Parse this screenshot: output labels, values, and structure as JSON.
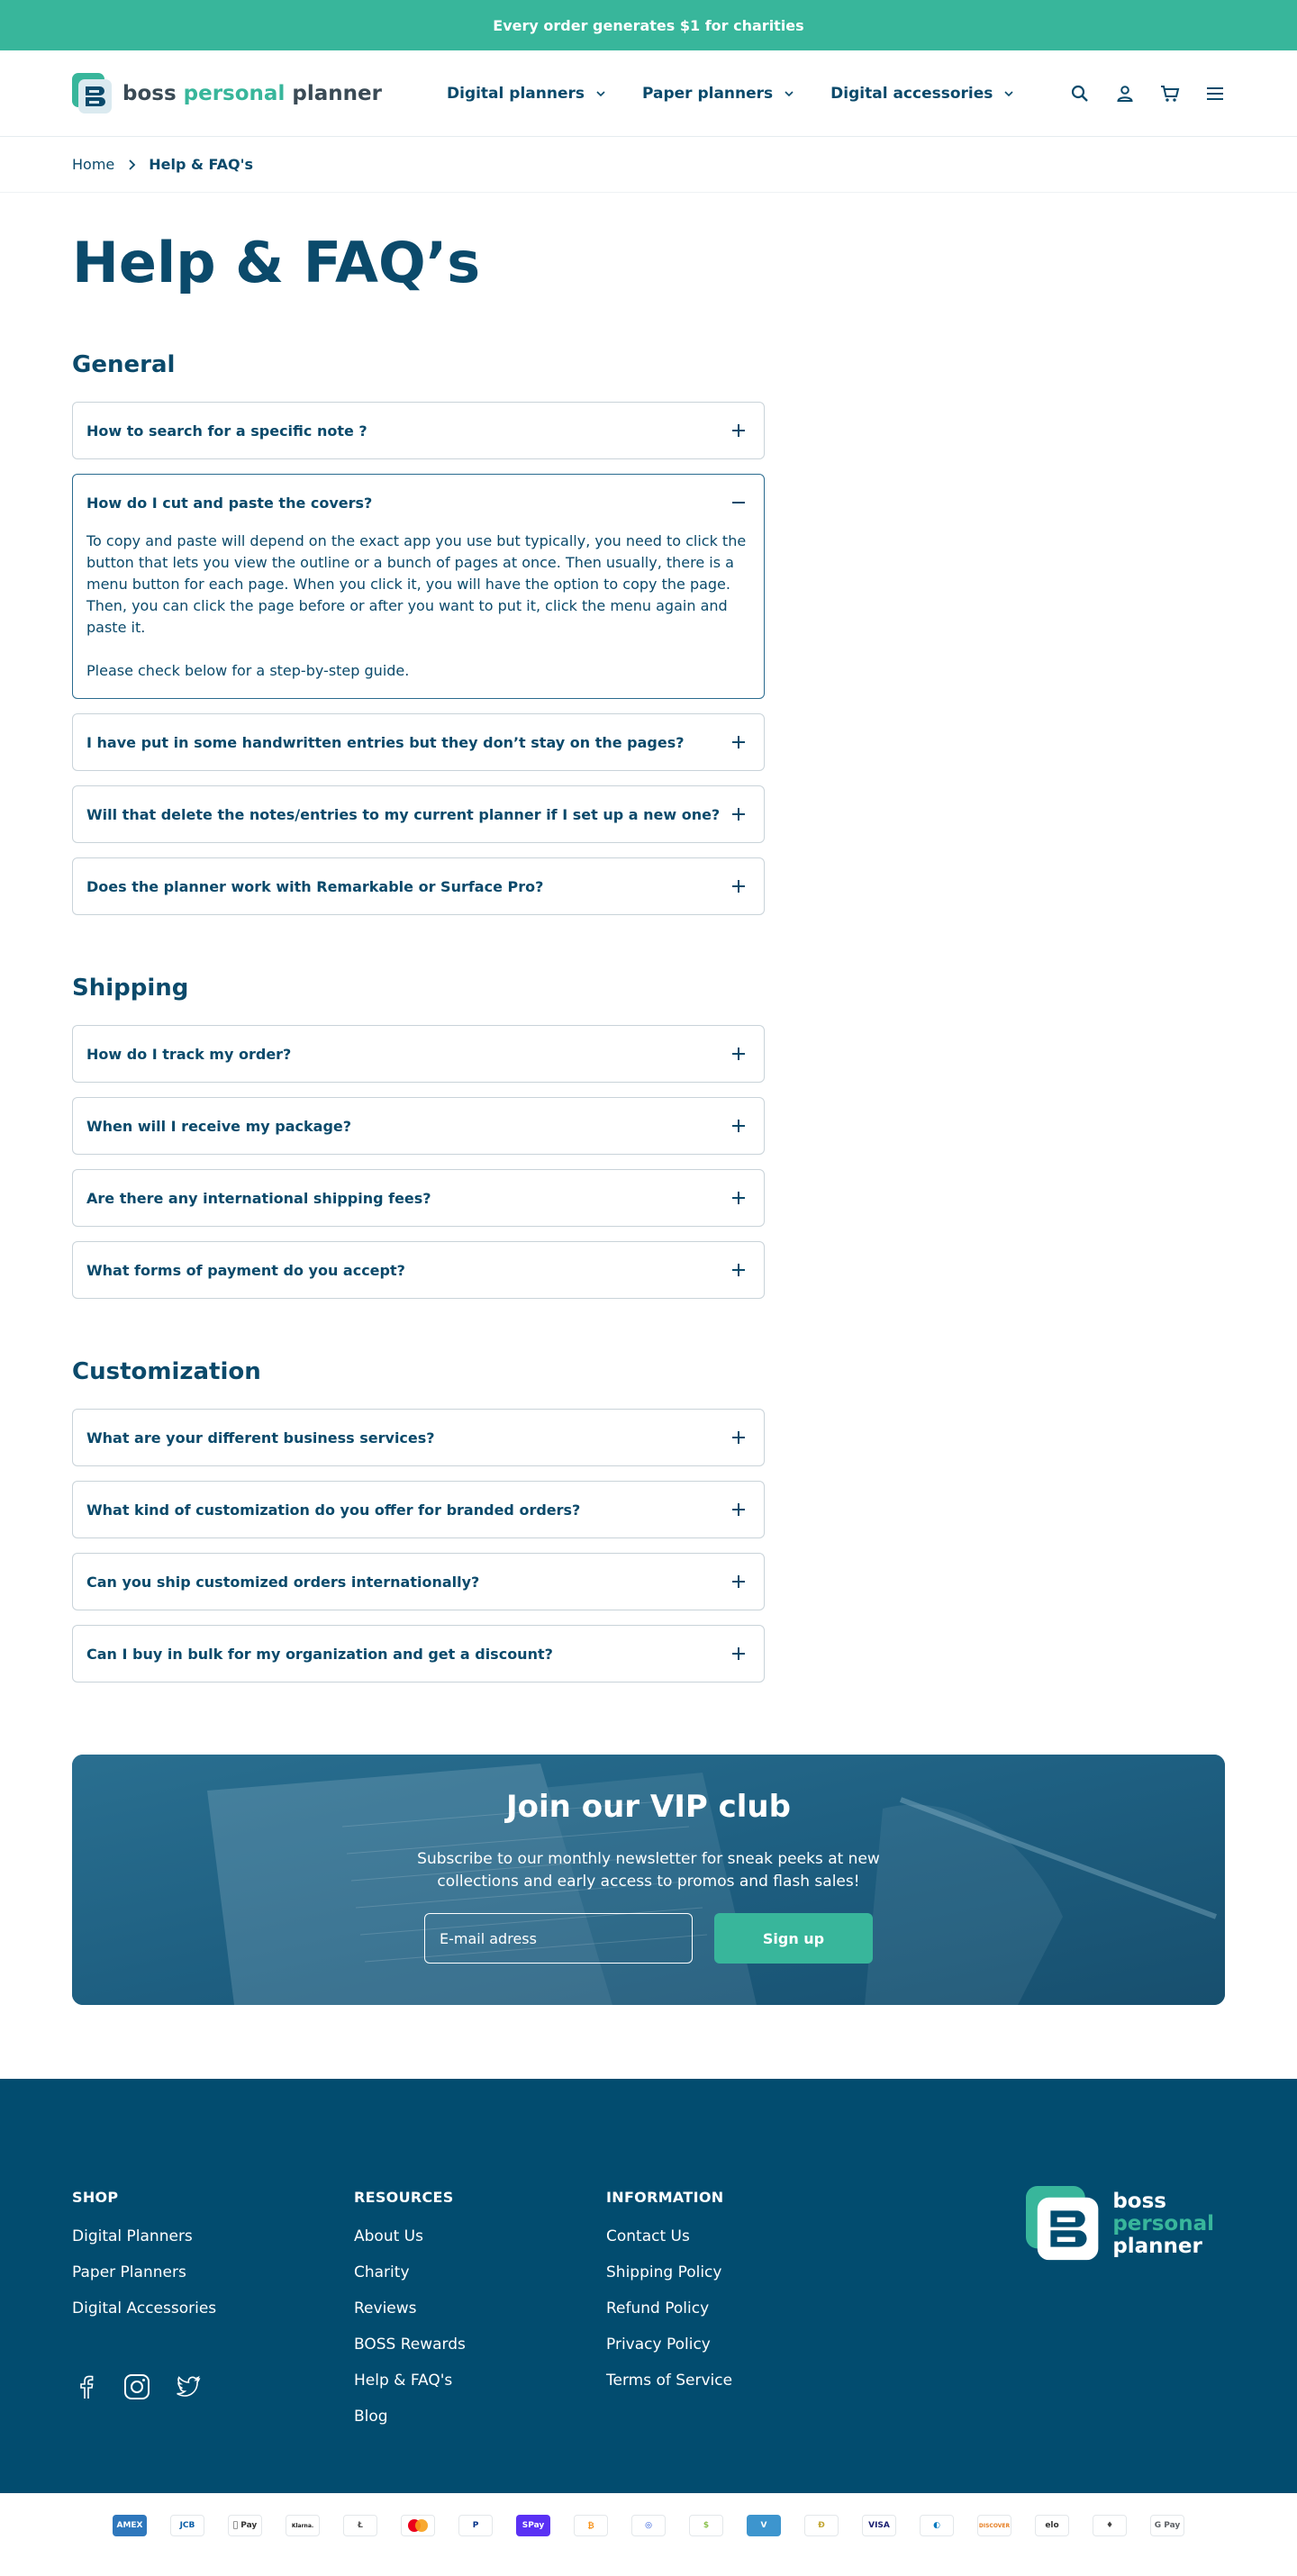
{
  "announcement": "Every order generates $1 for charities",
  "brand": {
    "part1": "boss ",
    "part2": "personal",
    "part3": " planner",
    "accent_color": "#38b69b",
    "primary_color": "#0b4a6b"
  },
  "nav": {
    "items": [
      {
        "label": "Digital planners"
      },
      {
        "label": "Paper planners"
      },
      {
        "label": "Digital accessories"
      }
    ],
    "icons": [
      "search-icon",
      "account-icon",
      "cart-icon",
      "menu-icon"
    ]
  },
  "breadcrumb": {
    "home": "Home",
    "current": "Help & FAQ's"
  },
  "page_title": "Help & FAQ’s",
  "sections": {
    "general": {
      "title": "General",
      "items": [
        {
          "q": "How to search for a specific note ?"
        },
        {
          "q": "How do I cut and paste the covers?",
          "open": true,
          "a1": "To copy and paste will depend on the exact app you use but typically, you need to click the button that lets you view the outline or a bunch of pages at once. Then usually, there is a menu button for each page. When you click it, you will have the option to copy the page. Then, you can click the page before or after you want to put it, click the menu again and paste it.",
          "a2": "Please check below for a step-by-step guide."
        },
        {
          "q": "I have put in some handwritten entries but they don’t stay on the pages?"
        },
        {
          "q": "Will that delete the notes/entries to my current planner if I set up a new one?"
        },
        {
          "q": "Does the planner work with Remarkable or Surface Pro?"
        }
      ]
    },
    "shipping": {
      "title": "Shipping",
      "items": [
        {
          "q": "How do I track my order?"
        },
        {
          "q": "When will I receive my package?"
        },
        {
          "q": "Are there any international shipping fees?"
        },
        {
          "q": "What forms of payment do you accept?"
        }
      ]
    },
    "customization": {
      "title": "Customization",
      "items": [
        {
          "q": "What are your different business services?"
        },
        {
          "q": "What kind of customization do you offer for branded orders?"
        },
        {
          "q": "Can you ship customized orders internationally?"
        },
        {
          "q": "Can I buy in bulk for my organization and get a discount?"
        }
      ]
    }
  },
  "vip": {
    "title": "Join our VIP club",
    "text": "Subscribe to our monthly newsletter for sneak peeks at new collections and early access to promos and flash sales!",
    "placeholder": "E-mail adress",
    "button": "Sign up"
  },
  "footer": {
    "shop": {
      "title": "SHOP",
      "links": [
        "Digital Planners",
        "Paper Planners",
        "Digital Accessories"
      ]
    },
    "resources": {
      "title": "RESOURCES",
      "links": [
        "About Us",
        "Charity",
        "Reviews",
        "BOSS Rewards",
        "Help & FAQ's",
        "Blog"
      ]
    },
    "information": {
      "title": "INFORMATION",
      "links": [
        "Contact Us",
        "Shipping Policy",
        "Refund Policy",
        "Privacy Policy",
        "Terms of Service"
      ]
    },
    "logo": {
      "line1": "boss",
      "line2": "personal",
      "line3": "planner"
    },
    "socials": [
      "facebook-icon",
      "instagram-icon",
      "twitter-icon"
    ],
    "background": "#024c6f"
  },
  "payments": [
    {
      "name": "amex",
      "label": "AMEX",
      "bg": "#2e77bc",
      "fg": "#ffffff"
    },
    {
      "name": "jcb",
      "label": "JCB",
      "bg": "#ffffff",
      "fg": "#0b5fa8"
    },
    {
      "name": "apple-pay",
      "label": " Pay",
      "bg": "#ffffff",
      "fg": "#333333"
    },
    {
      "name": "klarna",
      "label": "Klarna.",
      "bg": "#ffffff",
      "fg": "#222222"
    },
    {
      "name": "litecoin",
      "label": "Ł",
      "bg": "#ffffff",
      "fg": "#555555"
    },
    {
      "name": "mastercard",
      "label": "",
      "bg": "#ffffff",
      "fg": "#eb001b"
    },
    {
      "name": "paypal",
      "label": "P",
      "bg": "#ffffff",
      "fg": "#003087"
    },
    {
      "name": "shop-pay",
      "label": "SPay",
      "bg": "#5a31f4",
      "fg": "#ffffff"
    },
    {
      "name": "bitcoin",
      "label": "₿",
      "bg": "#ffffff",
      "fg": "#f7931a"
    },
    {
      "name": "crypto",
      "label": "◎",
      "bg": "#ffffff",
      "fg": "#1e4fd8"
    },
    {
      "name": "bitcoin-cash",
      "label": "$",
      "bg": "#ffffff",
      "fg": "#8dc351"
    },
    {
      "name": "venmo",
      "label": "V",
      "bg": "#3d95ce",
      "fg": "#ffffff"
    },
    {
      "name": "dogecoin",
      "label": "Ð",
      "bg": "#ffffff",
      "fg": "#c2a633"
    },
    {
      "name": "visa",
      "label": "VISA",
      "bg": "#ffffff",
      "fg": "#1a1f71"
    },
    {
      "name": "diners",
      "label": "◐",
      "bg": "#ffffff",
      "fg": "#0079be"
    },
    {
      "name": "discover",
      "label": "DISCOVER",
      "bg": "#ffffff",
      "fg": "#e67e22"
    },
    {
      "name": "elo",
      "label": "elo",
      "bg": "#ffffff",
      "fg": "#333333"
    },
    {
      "name": "ethereum",
      "label": "♦",
      "bg": "#ffffff",
      "fg": "#444444"
    },
    {
      "name": "google-pay",
      "label": "G Pay",
      "bg": "#ffffff",
      "fg": "#5f6368"
    }
  ]
}
